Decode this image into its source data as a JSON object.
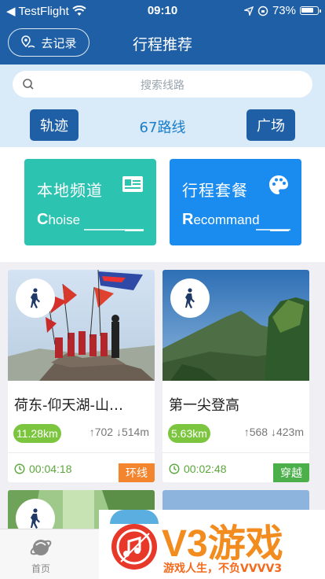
{
  "status_bar": {
    "carrier": "TestFlight",
    "time": "09:10",
    "battery": "73%"
  },
  "nav": {
    "record_label": "去记录",
    "title": "行程推荐"
  },
  "search": {
    "placeholder": "搜索线路"
  },
  "tabs_row": {
    "left_button": "轨迹",
    "route_count": "67路线",
    "right_button": "广场"
  },
  "features": [
    {
      "title": "本地频道",
      "subtitle_initial": "C",
      "subtitle_rest": "hoise",
      "color": "#2cc3b1",
      "icon": "id-card-icon"
    },
    {
      "title": "行程套餐",
      "subtitle_initial": "R",
      "subtitle_rest": "ecommand",
      "color": "#1a8cf0",
      "icon": "palette-icon"
    }
  ],
  "routes": [
    {
      "name": "荷东-仰天湖-山…",
      "distance": "11.28km",
      "ascent": "702",
      "descent": "514m",
      "duration": "00:04:18",
      "tag": "环线",
      "tag_color": "#f2852d"
    },
    {
      "name": "第一尖登高",
      "distance": "5.63km",
      "ascent": "568",
      "descent": "423m",
      "duration": "00:02:48",
      "tag": "穿越",
      "tag_color": "#4cb04a"
    }
  ],
  "tab_bar": {
    "home_label": "首页"
  },
  "watermark": {
    "brand": "V3游戏",
    "slogan": "游戏人生，不负VVVV3"
  },
  "colors": {
    "primary": "#1f5fa6",
    "accent_blue": "#1a7ec8",
    "green": "#7cc63f"
  }
}
